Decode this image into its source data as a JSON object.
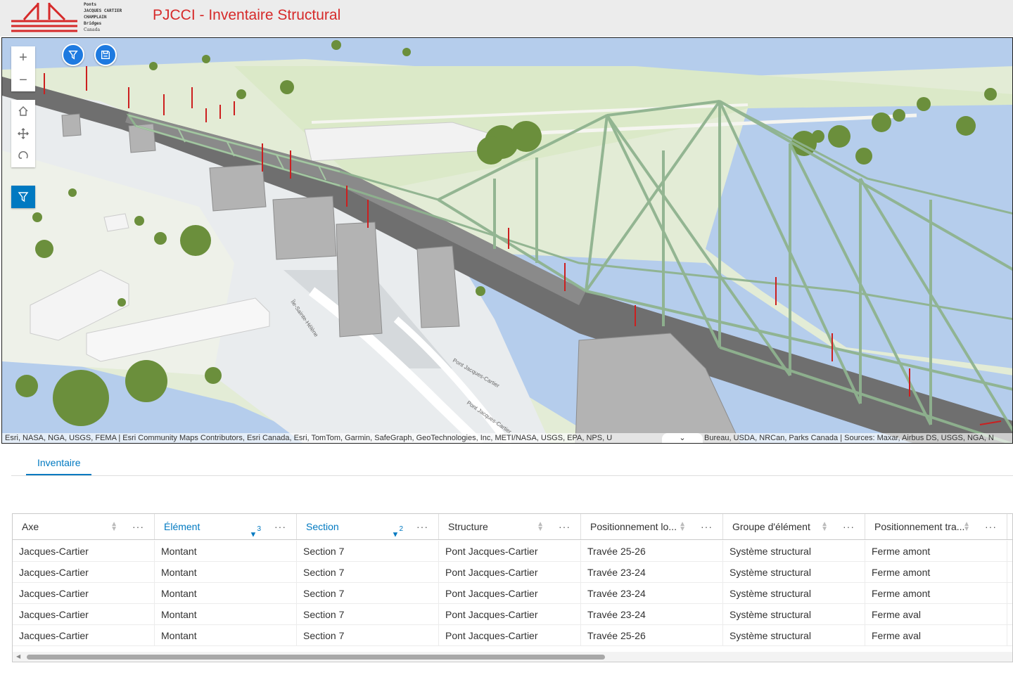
{
  "header": {
    "logo_lines": [
      "Ponts",
      "JACQUES CARTIER",
      "CHAMPLAIN",
      "Bridges",
      "Canada"
    ],
    "title": "PJCCI - Inventaire Structural"
  },
  "map": {
    "zoom_in": "+",
    "zoom_out": "−",
    "attribution_left": "Esri, NASA, NGA, USGS, FEMA | Esri Community Maps Contributors, Esri Canada, Esri, TomTom, Garmin, SafeGraph, GeoTechnologies, Inc, METI/NASA, USGS, EPA, NPS, U",
    "attribution_right": "Bureau, USDA, NRCan, Parks Canada | Sources: Maxar, Airbus DS, USGS, NGA, N",
    "attribution_toggle": "⌄",
    "road_labels": [
      "Île-Sainte-Hélène",
      "Pont Jacques-Cartier",
      "Pont Jacques-Cartier"
    ]
  },
  "colors": {
    "accent": "#0079c1",
    "brand_red": "#d62a2a",
    "truss": "#8fb38f",
    "water": "#b5cdec"
  },
  "panel": {
    "tabs": [
      {
        "label": "Inventaire"
      }
    ]
  },
  "table": {
    "columns": [
      {
        "label": "Axe"
      },
      {
        "label": "Élément",
        "sort_order": "3"
      },
      {
        "label": "Section",
        "sort_order": "2"
      },
      {
        "label": "Structure"
      },
      {
        "label": "Positionnement lo..."
      },
      {
        "label": "Groupe d'élément"
      },
      {
        "label": "Positionnement tra..."
      }
    ],
    "more_label": "···",
    "rows": [
      [
        "Jacques-Cartier",
        "Montant",
        "Section 7",
        "Pont Jacques-Cartier",
        "Travée 25-26",
        "Système structural",
        "Ferme amont"
      ],
      [
        "Jacques-Cartier",
        "Montant",
        "Section 7",
        "Pont Jacques-Cartier",
        "Travée 23-24",
        "Système structural",
        "Ferme amont"
      ],
      [
        "Jacques-Cartier",
        "Montant",
        "Section 7",
        "Pont Jacques-Cartier",
        "Travée 23-24",
        "Système structural",
        "Ferme amont"
      ],
      [
        "Jacques-Cartier",
        "Montant",
        "Section 7",
        "Pont Jacques-Cartier",
        "Travée 23-24",
        "Système structural",
        "Ferme aval"
      ],
      [
        "Jacques-Cartier",
        "Montant",
        "Section 7",
        "Pont Jacques-Cartier",
        "Travée 25-26",
        "Système structural",
        "Ferme aval"
      ]
    ]
  }
}
